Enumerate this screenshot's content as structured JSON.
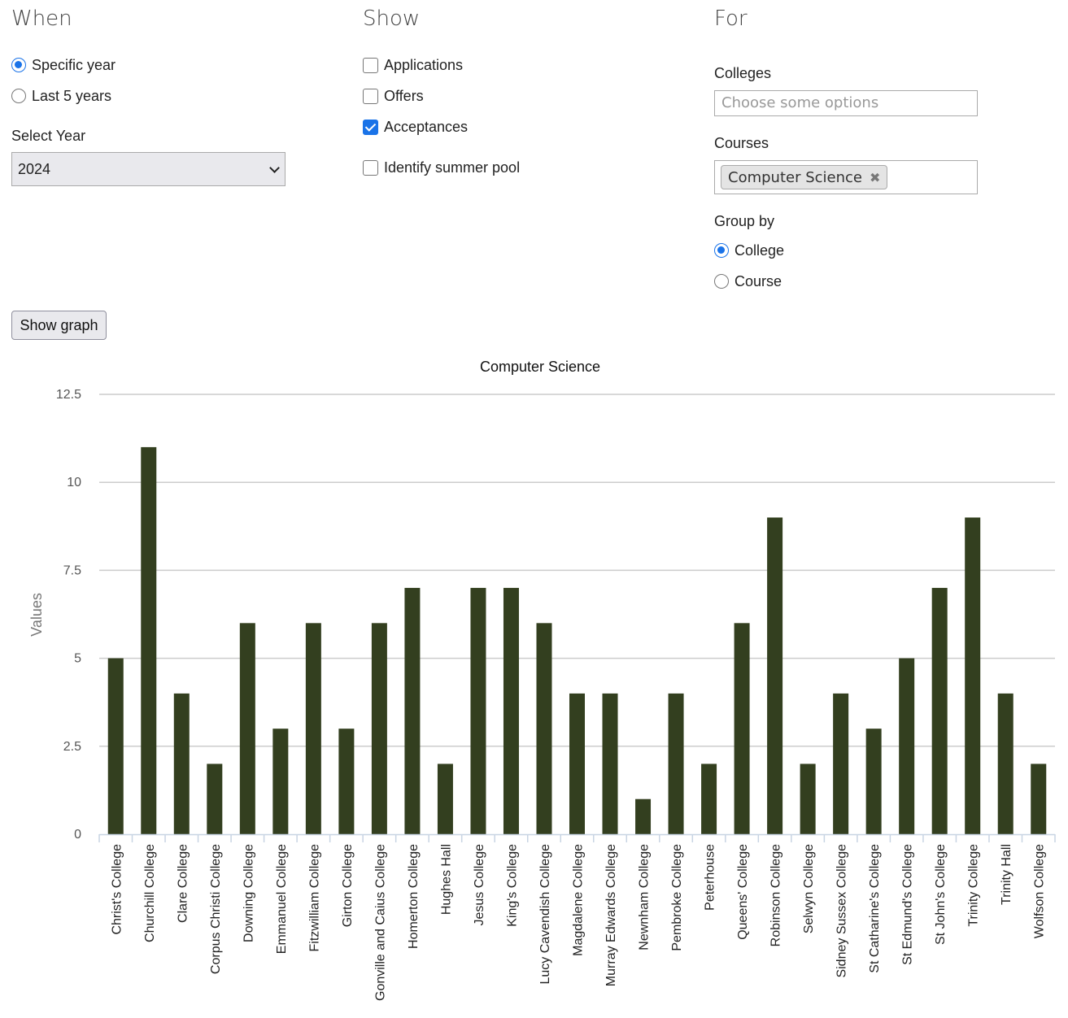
{
  "when": {
    "heading": "When",
    "options": [
      "Specific year",
      "Last 5 years"
    ],
    "selected": "Specific year",
    "year_label": "Select Year",
    "year_value": "2024"
  },
  "show": {
    "heading": "Show",
    "options": [
      {
        "label": "Applications",
        "checked": false
      },
      {
        "label": "Offers",
        "checked": false
      },
      {
        "label": "Acceptances",
        "checked": true
      }
    ],
    "summer_pool": {
      "label": "Identify summer pool",
      "checked": false
    }
  },
  "for": {
    "heading": "For",
    "colleges_label": "Colleges",
    "colleges_placeholder": "Choose some options",
    "courses_label": "Courses",
    "courses_selected": [
      "Computer Science"
    ],
    "group_by_label": "Group by",
    "group_by_options": [
      "College",
      "Course"
    ],
    "group_by_selected": "College"
  },
  "show_graph_label": "Show graph",
  "colors": {
    "accent": "#1a73e8",
    "bar": "#333f1f",
    "grid": "#cccccc"
  },
  "chart_data": {
    "type": "bar",
    "title": "Computer Science",
    "ylabel": "Values",
    "xlabel": "",
    "ylim": [
      0,
      12.5
    ],
    "yticks": [
      "0",
      "2.5",
      "5",
      "7.5",
      "10",
      "12.5"
    ],
    "grid": true,
    "categories": [
      "Christ's College",
      "Churchill College",
      "Clare College",
      "Corpus Christi College",
      "Downing College",
      "Emmanuel College",
      "Fitzwilliam College",
      "Girton College",
      "Gonville and Caius College",
      "Homerton College",
      "Hughes Hall",
      "Jesus College",
      "King's College",
      "Lucy Cavendish College",
      "Magdalene College",
      "Murray Edwards College",
      "Newnham College",
      "Pembroke College",
      "Peterhouse",
      "Queens' College",
      "Robinson College",
      "Selwyn College",
      "Sidney Sussex College",
      "St Catharine's College",
      "St Edmund's College",
      "St John's College",
      "Trinity College",
      "Trinity Hall",
      "Wolfson College"
    ],
    "values": [
      5,
      11,
      4,
      2,
      6,
      3,
      6,
      3,
      6,
      7,
      2,
      7,
      7,
      6,
      4,
      4,
      1,
      4,
      2,
      6,
      9,
      2,
      4,
      3,
      5,
      7,
      9,
      4,
      2
    ]
  }
}
